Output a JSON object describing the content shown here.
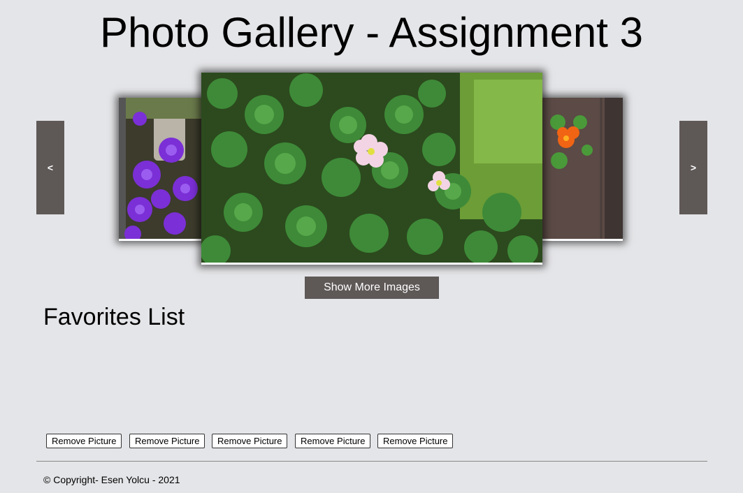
{
  "header": {
    "title": "Photo Gallery - Assignment 3"
  },
  "carousel": {
    "prev_label": "<",
    "next_label": ">",
    "show_more_label": "Show More Images"
  },
  "favorites": {
    "title": "Favorites List",
    "remove_label": "Remove Picture",
    "remove_buttons": [
      "Remove Picture",
      "Remove Picture",
      "Remove Picture",
      "Remove Picture",
      "Remove Picture"
    ]
  },
  "footer": {
    "copyright": "© Copyright- Esen Yolcu - 2021"
  },
  "colors": {
    "background": "#e4e5e8",
    "button": "#5e5857"
  }
}
